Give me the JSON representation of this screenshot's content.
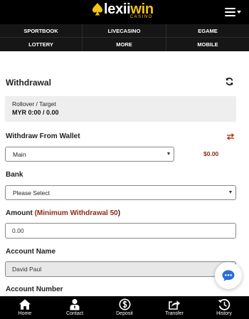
{
  "header": {
    "logo": {
      "main_prefix": "lexii",
      "main_suffix": "win",
      "sub": "CASINO"
    },
    "menu_icon": "hamburger-menu-icon"
  },
  "nav": {
    "items": [
      {
        "label": "SPORTBOOK"
      },
      {
        "label": "LIVECASINO"
      },
      {
        "label": "EGAME"
      },
      {
        "label": "LOTTERY"
      },
      {
        "label": "MORE"
      },
      {
        "label": "MOBILE"
      }
    ]
  },
  "withdrawal": {
    "title": "Withdrawal",
    "refresh_icon": "refresh-icon",
    "rollover_label": "Rollover / Target",
    "rollover_value": "MYR 0:00 / 0.00",
    "wallet_label": "Withdraw From Wallet",
    "wallet_selected": "Main",
    "wallet_balance": "$0.00",
    "swap_icon": "swap-arrows-icon",
    "bank_label": "Bank",
    "bank_selected": "Please Select",
    "amount_label": "Amount",
    "amount_open": "(",
    "amount_hint": "Minimum Withdrawal 50",
    "amount_close": ")",
    "amount_value": "0.00",
    "account_name_label": "Account Name",
    "account_name_value": "David Paul",
    "account_number_label": "Account Number"
  },
  "chat_icon": "chat-bubble-icon",
  "bottom_nav": {
    "items": [
      {
        "label": "Home",
        "icon": "home-icon"
      },
      {
        "label": "Contact",
        "icon": "contact-icon"
      },
      {
        "label": "Deposit",
        "icon": "deposit-icon"
      },
      {
        "label": "Transfer",
        "icon": "transfer-icon"
      },
      {
        "label": "History",
        "icon": "history-icon"
      }
    ]
  },
  "colors": {
    "header_bg": "#000000",
    "nav_bg": "#161616",
    "accent_gold": "#f2c418",
    "highlight_red": "#8e2a15",
    "chat_blue": "#2a6fd6"
  }
}
